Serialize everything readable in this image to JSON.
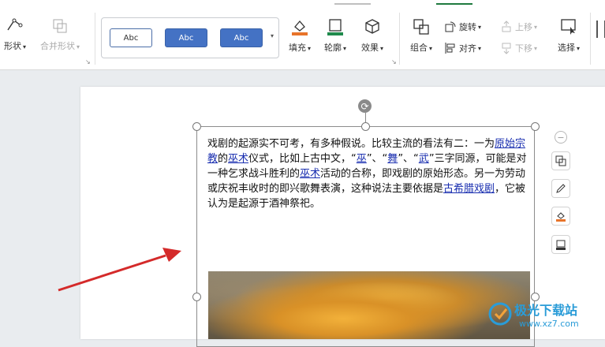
{
  "ribbon": {
    "shape_partial_label": "形状",
    "merge_shape_label": "合并形状",
    "style_samples": [
      "Abc",
      "Abc",
      "Abc"
    ],
    "fill_label": "填充",
    "outline_label": "轮廓",
    "effect_label": "效果",
    "group_label": "组合",
    "rotate_label": "旋转",
    "align_label": "对齐",
    "move_up_label": "上移",
    "move_down_label": "下移",
    "select_label": "选择"
  },
  "document": {
    "paragraph_segments": [
      {
        "t": "戏剧的起源实不可考，有多种假说。比较主流的看法有二：一为",
        "link": false
      },
      {
        "t": "原始宗教",
        "link": true
      },
      {
        "t": "的",
        "link": false
      },
      {
        "t": "巫术",
        "link": true
      },
      {
        "t": "仪式，比如上古中文，“",
        "link": false
      },
      {
        "t": "巫",
        "link": true
      },
      {
        "t": "”、“",
        "link": false
      },
      {
        "t": "舞",
        "link": true
      },
      {
        "t": "”、“",
        "link": false
      },
      {
        "t": "武",
        "link": true
      },
      {
        "t": "”三字同源，可能是对一种乞求战斗胜利的",
        "link": false
      },
      {
        "t": "巫术",
        "link": true
      },
      {
        "t": "活动的合称，即戏剧的原始形态。另一为劳动或庆祝丰收时的即兴歌舞表演，这种说法主要依据是",
        "link": false
      },
      {
        "t": "古希腊戏剧",
        "link": true
      },
      {
        "t": "，它被认为是起源于酒神祭祀。",
        "link": false
      }
    ]
  },
  "watermark": {
    "title": "极光下载站",
    "url": "www.xz7.com"
  },
  "colors": {
    "accent": "#1f7a3f",
    "link": "#1a2fb0",
    "arrow": "#d42a2a",
    "style_blue": "#4472c4"
  }
}
